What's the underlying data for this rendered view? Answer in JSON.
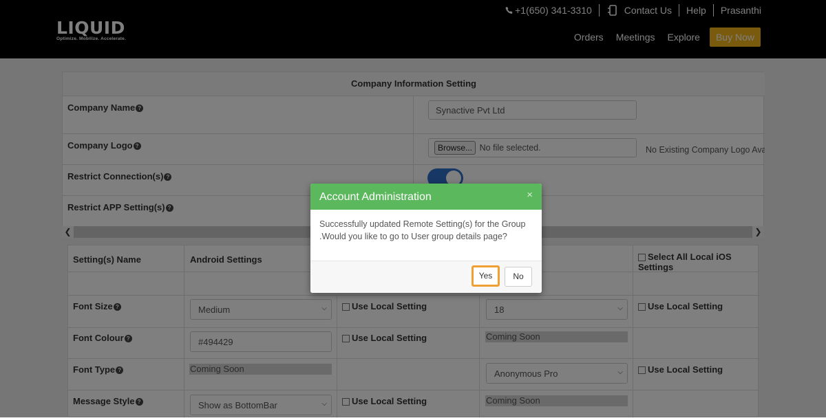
{
  "header": {
    "logo_text": "LIQUID",
    "logo_tagline": "Optimize. Mobilize. Accelerate.",
    "phone": "+1(650) 341-3310",
    "contact": "Contact Us",
    "help": "Help",
    "user": "Prasanthi",
    "nav": [
      "Orders",
      "Meetings",
      "Explore"
    ],
    "buy_now": "Buy Now",
    "accent_color": "#f4b41a"
  },
  "company_panel": {
    "title": "Company Information Setting",
    "company_name_label": "Company Name",
    "company_name_value": "Synactive Pvt Ltd",
    "company_logo_label": "Company Logo",
    "browse_label": "Browse...",
    "no_file": "No file selected.",
    "no_logo": "No Existing Company Logo Avai",
    "restrict_connection_label": "Restrict Connection(s)",
    "restrict_connection_on": true,
    "restrict_app_label": "Restrict APP Setting(s)"
  },
  "settings_grid": {
    "col_name": "Setting(s) Name",
    "col_android": "Android Settings",
    "col_select_ios": "Select All Local iOS Settings",
    "use_local": "Use Local Setting",
    "coming_soon": "Coming Soon",
    "rows": [
      {
        "name": "Font Size",
        "android": "Medium",
        "ios": "18"
      },
      {
        "name": "Font Colour",
        "android": "#494429"
      },
      {
        "name": "Font Type",
        "ios": "Anonymous Pro"
      },
      {
        "name": "Message Style",
        "android": "Show as BottomBar"
      }
    ]
  },
  "modal": {
    "title": "Account Administration",
    "close": "×",
    "message_line1": "Successfully updated Remote Setting(s) for the Group",
    "message_line2": ".Would you like to go to User group details page?",
    "yes": "Yes",
    "no": "No",
    "header_color": "#5cb85c"
  }
}
